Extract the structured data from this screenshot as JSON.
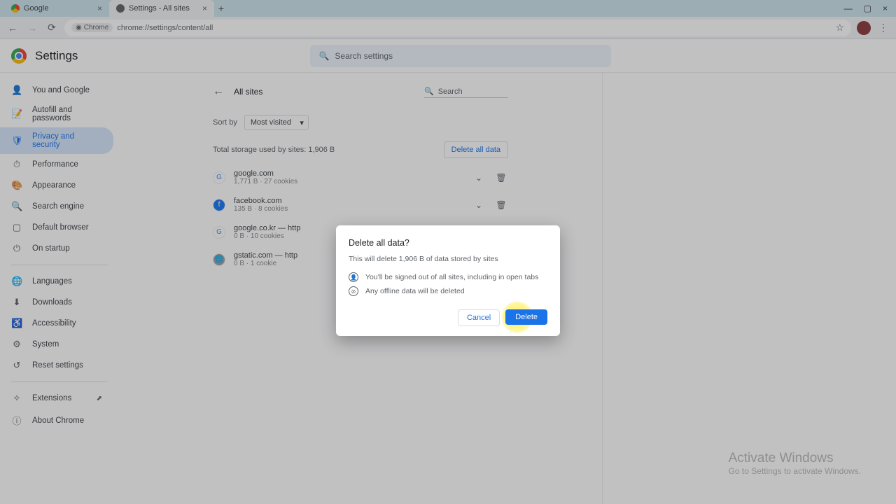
{
  "tabs": [
    {
      "title": "Google"
    },
    {
      "title": "Settings - All sites"
    }
  ],
  "address": {
    "chip": "Chrome",
    "url": "chrome://settings/content/all"
  },
  "header": {
    "title": "Settings",
    "search_placeholder": "Search settings"
  },
  "sidebar": {
    "items": [
      {
        "label": "You and Google",
        "icon": "👤"
      },
      {
        "label": "Autofill and passwords",
        "icon": "📝"
      },
      {
        "label": "Privacy and security",
        "icon": "🛡"
      },
      {
        "label": "Performance",
        "icon": "⏱"
      },
      {
        "label": "Appearance",
        "icon": "🎨"
      },
      {
        "label": "Search engine",
        "icon": "🔍"
      },
      {
        "label": "Default browser",
        "icon": "▢"
      },
      {
        "label": "On startup",
        "icon": "⏻"
      }
    ],
    "items2": [
      {
        "label": "Languages",
        "icon": "🌐"
      },
      {
        "label": "Downloads",
        "icon": "⬇"
      },
      {
        "label": "Accessibility",
        "icon": "♿"
      },
      {
        "label": "System",
        "icon": "⚙"
      },
      {
        "label": "Reset settings",
        "icon": "↺"
      }
    ],
    "items3": [
      {
        "label": "Extensions",
        "icon": "✧",
        "ext": "⬈"
      },
      {
        "label": "About Chrome",
        "icon": "ⓘ"
      }
    ]
  },
  "panel": {
    "title": "All sites",
    "search_placeholder": "Search",
    "sort_label": "Sort by",
    "sort_value": "Most visited",
    "storage_text": "Total storage used by sites: 1,906 B",
    "delete_all": "Delete all data",
    "sites": [
      {
        "name": "google.com",
        "meta": "1,771 B · 27 cookies",
        "favicon_bg": "#fff",
        "favicon_text": "G",
        "favicon_color": "#4285f4",
        "chev": "⌄"
      },
      {
        "name": "facebook.com",
        "meta": "135 B · 8 cookies",
        "favicon_bg": "#1877f2",
        "favicon_text": "f",
        "favicon_color": "#fff",
        "chev": "⌄"
      },
      {
        "name": "google.co.kr — http",
        "meta": "0 B · 10 cookies",
        "favicon_bg": "#fff",
        "favicon_text": "G",
        "favicon_color": "#4285f4",
        "chev": "›"
      },
      {
        "name": "gstatic.com — http",
        "meta": "0 B · 1 cookie",
        "favicon_bg": "#9aa0a6",
        "favicon_text": "🌐",
        "favicon_color": "#fff",
        "chev": "›"
      }
    ]
  },
  "dialog": {
    "title": "Delete all data?",
    "desc": "This will delete 1,906 B of data stored by sites",
    "bullet1": "You'll be signed out of all sites, including in open tabs",
    "bullet2": "Any offline data will be deleted",
    "cancel": "Cancel",
    "delete": "Delete"
  },
  "watermark": {
    "line1": "Activate Windows",
    "line2": "Go to Settings to activate Windows."
  }
}
